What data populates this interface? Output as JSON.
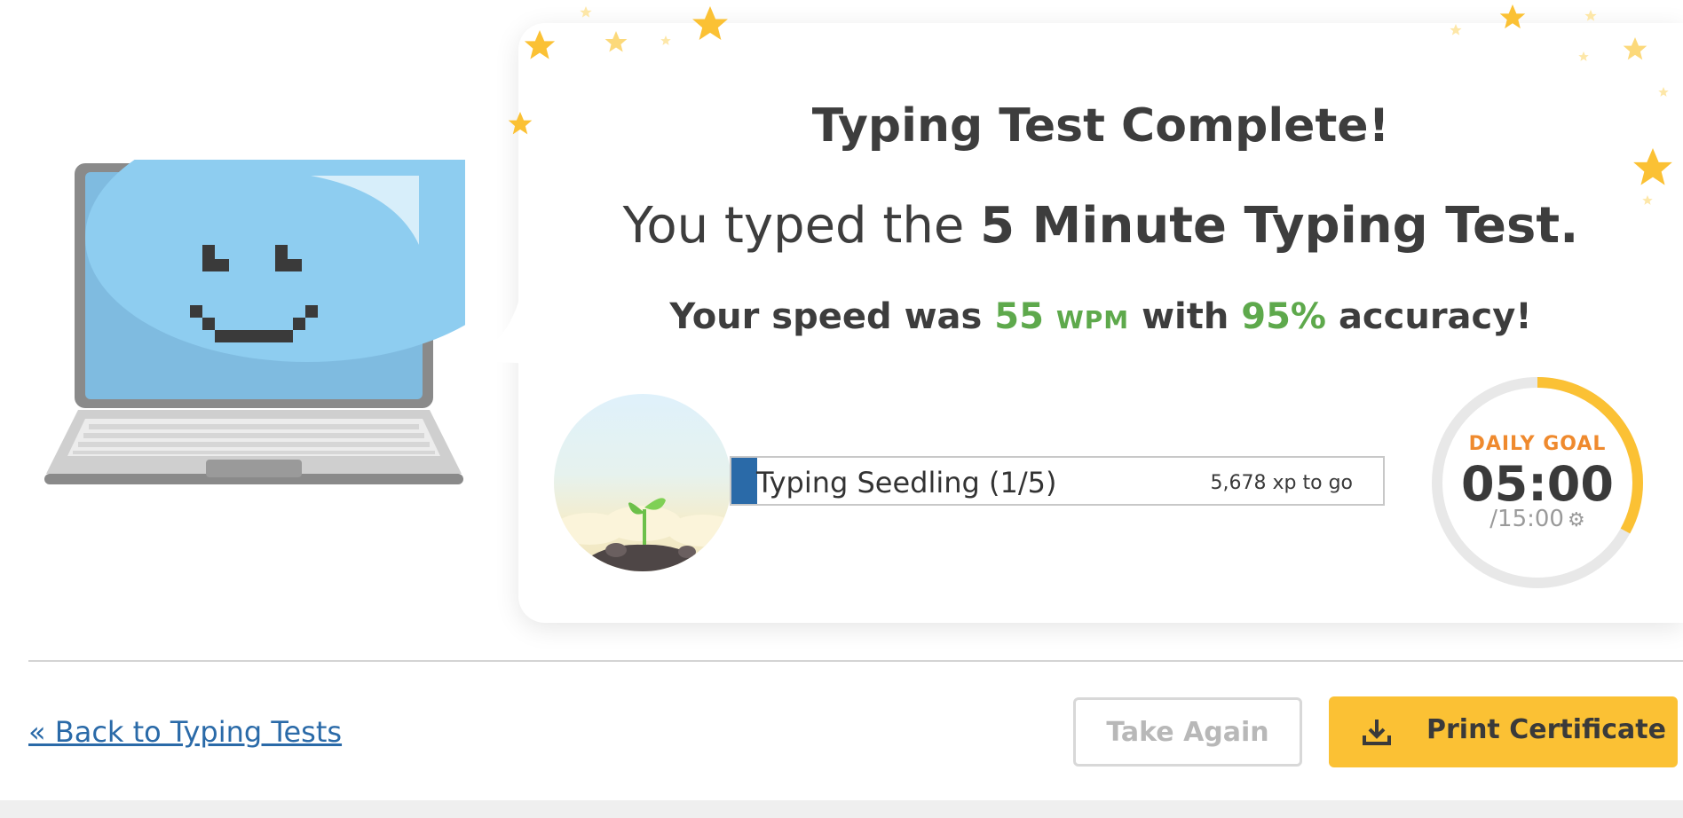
{
  "result": {
    "title": "Typing Test Complete!",
    "subtitle_prefix": "You typed the ",
    "subtitle_test": "5 Minute Typing Test.",
    "speed_prefix": "Your speed was ",
    "speed_value": "55",
    "speed_unit": "WPM",
    "speed_mid": " with ",
    "accuracy_value": "95%",
    "speed_suffix": " accuracy!"
  },
  "progress": {
    "level_label": "Typing Seedling (1/5)",
    "xp_to_go": "5,678 xp to go",
    "fill_fraction": 0.04
  },
  "daily_goal": {
    "label": "DAILY GOAL",
    "time": "05:00",
    "total": "/15:00",
    "fraction": 0.33
  },
  "footer": {
    "back_link": "« Back to Typing Tests",
    "take_again": "Take Again",
    "print_certificate": "Print Certificate"
  },
  "colors": {
    "accent_green": "#5ea94c",
    "link_blue": "#2a6aa8",
    "goal_orange": "#ef8a2e",
    "goal_ring_yellow": "#fbc134",
    "button_yellow": "#fbc134"
  }
}
